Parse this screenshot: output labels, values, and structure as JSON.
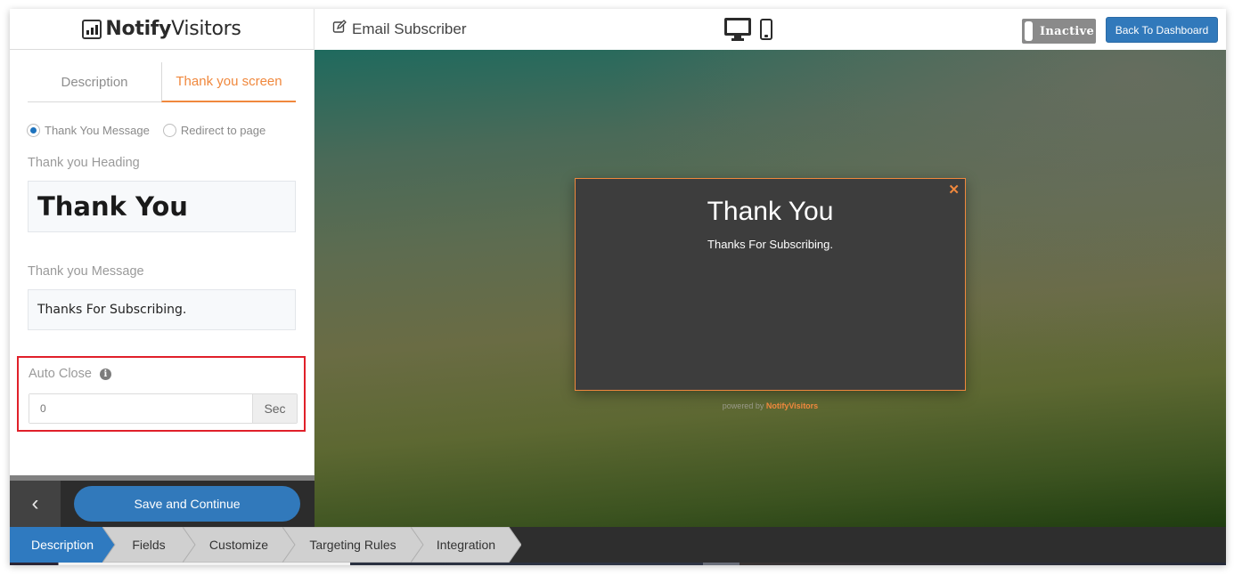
{
  "app": {
    "logo_bold": "Notify",
    "logo_regular": "Visitors"
  },
  "sidebar": {
    "tabs": [
      {
        "label": "Description",
        "active": false
      },
      {
        "label": "Thank you screen",
        "active": true
      }
    ],
    "radio_options": [
      {
        "label": "Thank You Message",
        "checked": true
      },
      {
        "label": "Redirect to page",
        "checked": false
      }
    ],
    "heading_label": "Thank you Heading",
    "heading_value": "Thank You",
    "message_label": "Thank you Message",
    "message_value": "Thanks For Subscribing.",
    "auto_close": {
      "label": "Auto Close",
      "info_icon": "info-circle-icon",
      "value": "0",
      "unit": "Sec"
    },
    "footer": {
      "back_icon": "chevron-left-icon",
      "save_label": "Save and Continue"
    }
  },
  "topbar": {
    "edit_icon": "edit-icon",
    "title": "Email Subscriber",
    "device_icons": [
      "desktop-icon",
      "mobile-icon"
    ],
    "status_label": "Inactive",
    "dashboard_label": "Back To Dashboard"
  },
  "preview": {
    "popup_heading": "Thank You",
    "popup_message": "Thanks For Subscribing.",
    "close_glyph": "✕",
    "powered_by": "powered by",
    "powered_brand": "NotifyVisitors"
  },
  "steps": [
    {
      "label": "Description",
      "active": true
    },
    {
      "label": "Fields",
      "active": false
    },
    {
      "label": "Customize",
      "active": false
    },
    {
      "label": "Targeting Rules",
      "active": false
    },
    {
      "label": "Integration",
      "active": false
    }
  ],
  "colors": {
    "accent_orange": "#f0883d",
    "primary_blue": "#3179bb",
    "highlight_red": "#e0202a",
    "popup_bg": "#3d3d3d"
  }
}
